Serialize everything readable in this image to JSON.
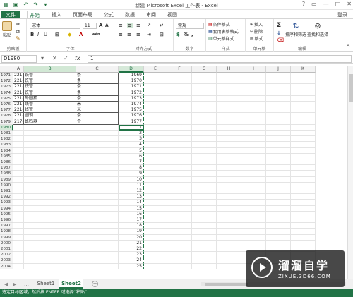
{
  "window": {
    "title": "新建 Microsoft Excel 工作表 - Excel",
    "signin": "登录",
    "controls": [
      "?",
      "▭",
      "—",
      "□",
      "✕"
    ]
  },
  "tabs": [
    "文件",
    "开始",
    "插入",
    "页面布局",
    "公式",
    "数据",
    "审阅",
    "视图"
  ],
  "active_tab": "开始",
  "ribbon": {
    "clipboard": {
      "label": "剪贴板",
      "paste": "粘贴"
    },
    "font": {
      "label": "字体",
      "name": "宋体",
      "size": "11",
      "bold": "B",
      "italic": "I",
      "underline": "U",
      "grow": "A",
      "shrink": "A",
      "color_letter": "A",
      "wen": "wén"
    },
    "alignment": {
      "label": "对齐方式"
    },
    "number": {
      "label": "数字",
      "format": "常规",
      "percent": "%",
      "comma": ","
    },
    "styles": {
      "label": "样式",
      "conditional": "条件格式",
      "table": "套用表格格式",
      "cell": "单元格样式"
    },
    "cells": {
      "label": "单元格",
      "insert": "插入",
      "delete": "删除",
      "format": "格式"
    },
    "editing": {
      "label": "编辑",
      "sum": "Σ",
      "sort": "排序和筛选",
      "find": "查找和选择"
    }
  },
  "formula_bar": {
    "name_box": "D1980",
    "cancel": "✕",
    "enter": "✓",
    "fx": "fx",
    "value": "1"
  },
  "columns": [
    "A",
    "B",
    "C",
    "D",
    "E",
    "F",
    "G",
    "H",
    "I",
    "J",
    "K"
  ],
  "rows": [
    {
      "num": "1971",
      "a": "221-2",
      "b": "铁管",
      "c": "条",
      "d": "1969"
    },
    {
      "num": "1972",
      "a": "221-2",
      "b": "铁管",
      "c": "条",
      "d": "1970"
    },
    {
      "num": "1973",
      "a": "221-2",
      "b": "铁管",
      "c": "条",
      "d": "1971"
    },
    {
      "num": "1974",
      "a": "221-2",
      "b": "铁管",
      "c": "条",
      "d": "1972"
    },
    {
      "num": "1975",
      "a": "221-2",
      "b": "外圆孤",
      "c": "条",
      "d": "1973"
    },
    {
      "num": "1976",
      "a": "221-3",
      "b": "线管",
      "c": "米",
      "d": "1974"
    },
    {
      "num": "1977",
      "a": "221-4",
      "b": "线管",
      "c": "米",
      "d": "1975"
    },
    {
      "num": "1978",
      "a": "221-2",
      "b": "圆钢",
      "c": "条",
      "d": "1976"
    },
    {
      "num": "1979",
      "a": "217-3",
      "b": "蜂鸣器",
      "c": "个",
      "d": "1977"
    },
    {
      "num": "1980",
      "a": "",
      "b": "",
      "c": "",
      "d": "1"
    },
    {
      "num": "1981",
      "a": "",
      "b": "",
      "c": "",
      "d": "2"
    },
    {
      "num": "1982",
      "a": "",
      "b": "",
      "c": "",
      "d": "3"
    },
    {
      "num": "1983",
      "a": "",
      "b": "",
      "c": "",
      "d": "4"
    },
    {
      "num": "1984",
      "a": "",
      "b": "",
      "c": "",
      "d": "5"
    },
    {
      "num": "1985",
      "a": "",
      "b": "",
      "c": "",
      "d": "6"
    },
    {
      "num": "1986",
      "a": "",
      "b": "",
      "c": "",
      "d": "7"
    },
    {
      "num": "1987",
      "a": "",
      "b": "",
      "c": "",
      "d": "8"
    },
    {
      "num": "1988",
      "a": "",
      "b": "",
      "c": "",
      "d": "9"
    },
    {
      "num": "1989",
      "a": "",
      "b": "",
      "c": "",
      "d": "10"
    },
    {
      "num": "1990",
      "a": "",
      "b": "",
      "c": "",
      "d": "11"
    },
    {
      "num": "1991",
      "a": "",
      "b": "",
      "c": "",
      "d": "12"
    },
    {
      "num": "1992",
      "a": "",
      "b": "",
      "c": "",
      "d": "13"
    },
    {
      "num": "1993",
      "a": "",
      "b": "",
      "c": "",
      "d": "14"
    },
    {
      "num": "1994",
      "a": "",
      "b": "",
      "c": "",
      "d": "15"
    },
    {
      "num": "1995",
      "a": "",
      "b": "",
      "c": "",
      "d": "16"
    },
    {
      "num": "1996",
      "a": "",
      "b": "",
      "c": "",
      "d": "17"
    },
    {
      "num": "1997",
      "a": "",
      "b": "",
      "c": "",
      "d": "18"
    },
    {
      "num": "1998",
      "a": "",
      "b": "",
      "c": "",
      "d": "19"
    },
    {
      "num": "1999",
      "a": "",
      "b": "",
      "c": "",
      "d": "20"
    },
    {
      "num": "2000",
      "a": "",
      "b": "",
      "c": "",
      "d": "21"
    },
    {
      "num": "2001",
      "a": "",
      "b": "",
      "c": "",
      "d": "22"
    },
    {
      "num": "2002",
      "a": "",
      "b": "",
      "c": "",
      "d": "23"
    },
    {
      "num": "2003",
      "a": "",
      "b": "",
      "c": "",
      "d": "24"
    },
    {
      "num": "2004",
      "a": "",
      "b": "",
      "c": "",
      "d": "25"
    }
  ],
  "sheets": [
    "Sheet1",
    "Sheet2"
  ],
  "active_sheet": "Sheet2",
  "add_sheet": "+",
  "status": "选定目标区域，然后按 ENTER 或选择“粘贴”",
  "watermark": {
    "title": "溜溜自学",
    "sub": "ZIXUE.3D66.COM"
  },
  "colors": {
    "accent": "#217346",
    "header_bg": "#f3f3f3",
    "selected_header": "#d6e9d9"
  }
}
